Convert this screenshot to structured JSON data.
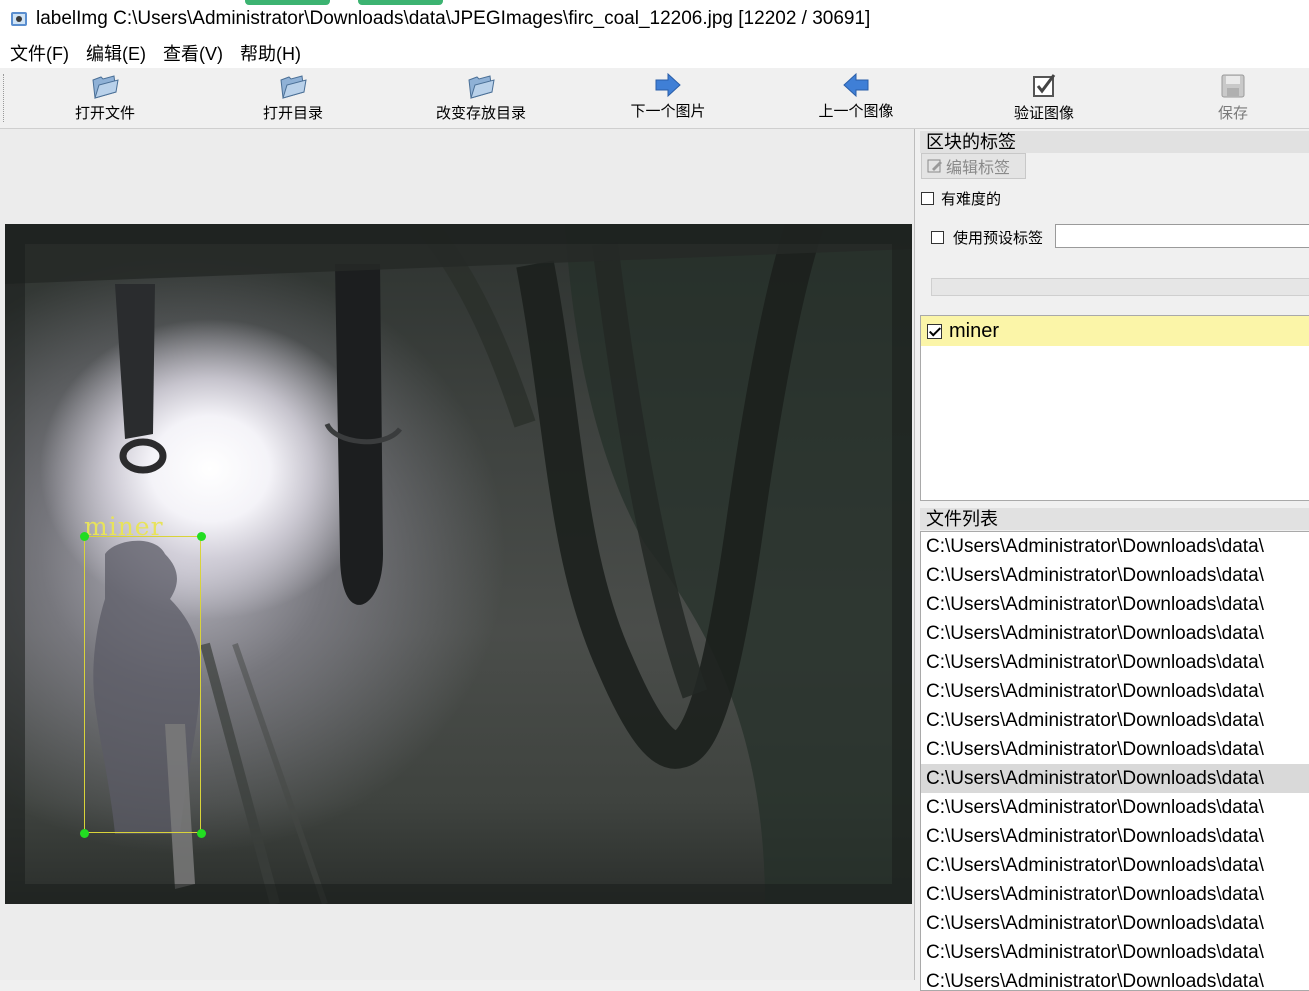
{
  "window": {
    "title": "labelImg C:\\Users\\Administrator\\Downloads\\data\\JPEGImages\\firc_coal_12206.jpg [12202 / 30691]"
  },
  "menu": [
    "文件(F)",
    "编辑(E)",
    "查看(V)",
    "帮助(H)"
  ],
  "toolbar": {
    "open_file": "打开文件",
    "open_dir": "打开目录",
    "change_save_dir": "改变存放目录",
    "next_image": "下一个图片",
    "prev_image": "上一个图像",
    "verify_image": "验证图像",
    "save": "保存"
  },
  "annotation": {
    "label": "miner"
  },
  "dock": {
    "box_labels_title": "区块的标签",
    "edit_label_button": "编辑标签",
    "difficult_label": "有难度的",
    "use_default_label": "使用预设标签",
    "label_items": [
      {
        "label": "miner",
        "checked": true
      }
    ],
    "file_list_title": "文件列表",
    "file_list": [
      "C:\\Users\\Administrator\\Downloads\\data\\",
      "C:\\Users\\Administrator\\Downloads\\data\\",
      "C:\\Users\\Administrator\\Downloads\\data\\",
      "C:\\Users\\Administrator\\Downloads\\data\\",
      "C:\\Users\\Administrator\\Downloads\\data\\",
      "C:\\Users\\Administrator\\Downloads\\data\\",
      "C:\\Users\\Administrator\\Downloads\\data\\",
      "C:\\Users\\Administrator\\Downloads\\data\\",
      "C:\\Users\\Administrator\\Downloads\\data\\",
      "C:\\Users\\Administrator\\Downloads\\data\\",
      "C:\\Users\\Administrator\\Downloads\\data\\",
      "C:\\Users\\Administrator\\Downloads\\data\\",
      "C:\\Users\\Administrator\\Downloads\\data\\",
      "C:\\Users\\Administrator\\Downloads\\data\\",
      "C:\\Users\\Administrator\\Downloads\\data\\",
      "C:\\Users\\Administrator\\Downloads\\data\\"
    ],
    "selected_file_index": 8
  },
  "colors": {
    "label_highlight": "#fbf5a8",
    "bbox_color": "#d9d33a",
    "handle_color": "#22dd22",
    "arrow_blue": "#3f7fd6"
  }
}
